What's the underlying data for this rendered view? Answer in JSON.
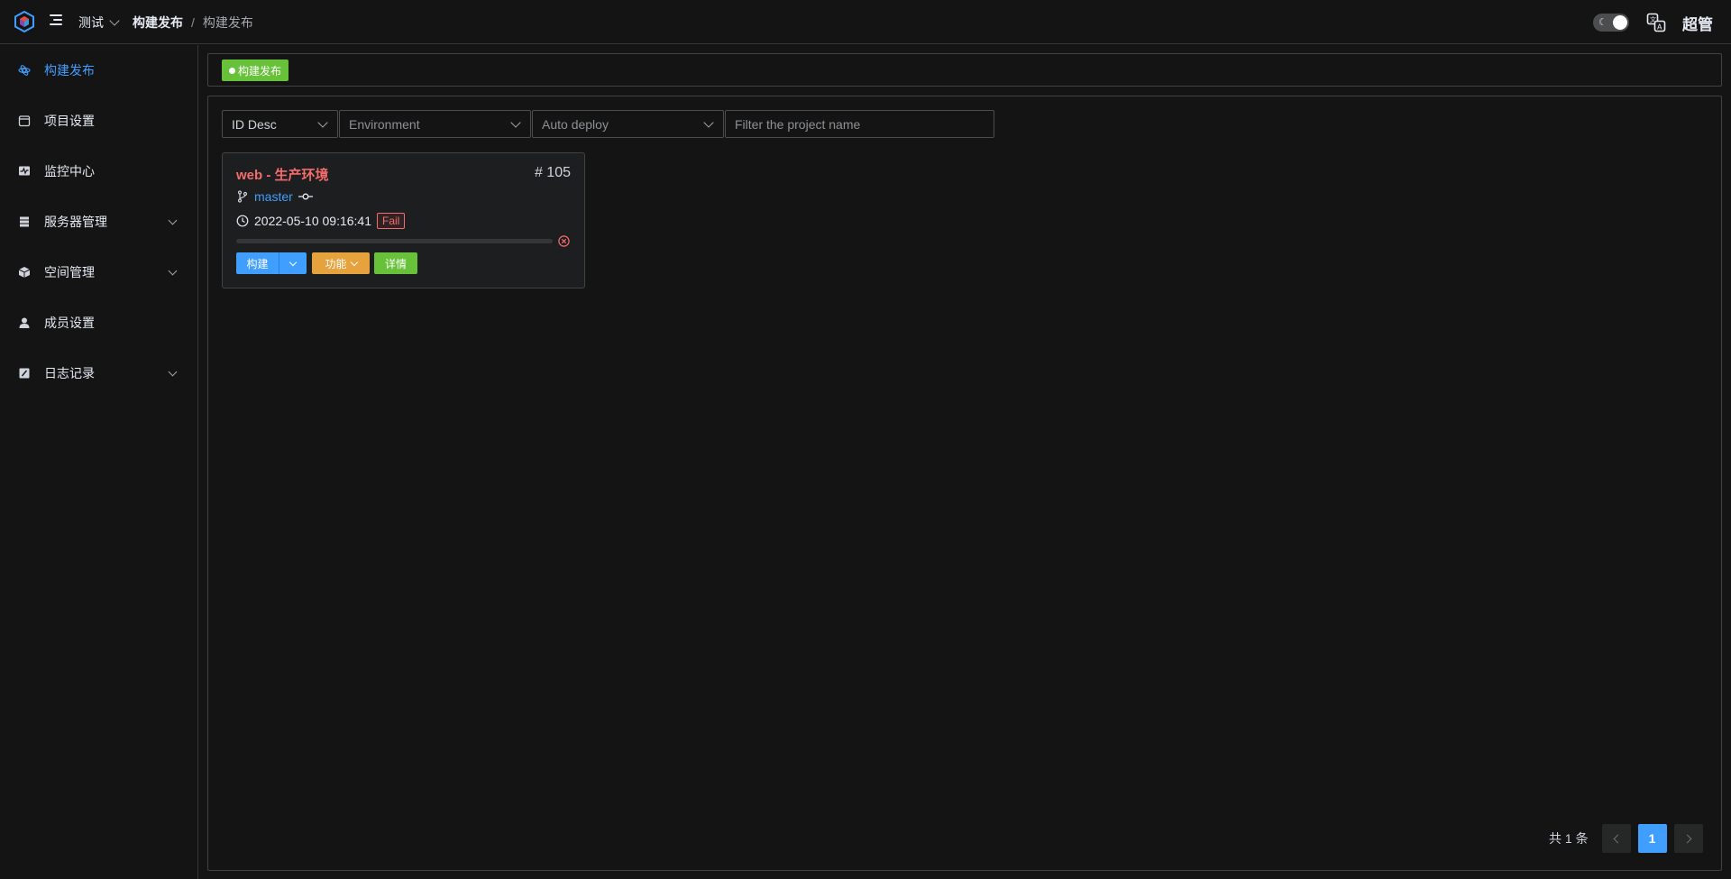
{
  "header": {
    "workspace": "测试",
    "breadcrumb": [
      "构建发布",
      "构建发布"
    ],
    "breadcrumb_separator": "/",
    "user": "超管"
  },
  "sidebar": {
    "items": [
      {
        "label": "构建发布",
        "icon": "build-icon",
        "active": true,
        "expandable": false
      },
      {
        "label": "项目设置",
        "icon": "project-icon",
        "active": false,
        "expandable": false
      },
      {
        "label": "监控中心",
        "icon": "monitor-icon",
        "active": false,
        "expandable": false
      },
      {
        "label": "服务器管理",
        "icon": "server-icon",
        "active": false,
        "expandable": true
      },
      {
        "label": "空间管理",
        "icon": "namespace-icon",
        "active": false,
        "expandable": true
      },
      {
        "label": "成员设置",
        "icon": "member-icon",
        "active": false,
        "expandable": false
      },
      {
        "label": "日志记录",
        "icon": "log-icon",
        "active": false,
        "expandable": true
      }
    ]
  },
  "tagbar": {
    "tag": "构建发布"
  },
  "filters": {
    "sort": "ID Desc",
    "environment_placeholder": "Environment",
    "auto_deploy_placeholder": "Auto deploy",
    "search_placeholder": "Filter the project name"
  },
  "card": {
    "title": "web - 生产环境",
    "id_label": "# 105",
    "branch": "master",
    "time": "2022-05-10 09:16:41",
    "status": "Fail",
    "progress": 0,
    "buttons": {
      "build": "构建",
      "func": "功能",
      "detail": "详情"
    }
  },
  "pagination": {
    "total": "共 1 条",
    "current_page": "1"
  },
  "colors": {
    "accent": "#409eff",
    "success": "#67c23a",
    "warning": "#e6a23c",
    "danger": "#f56c6c",
    "background": "#141414"
  }
}
